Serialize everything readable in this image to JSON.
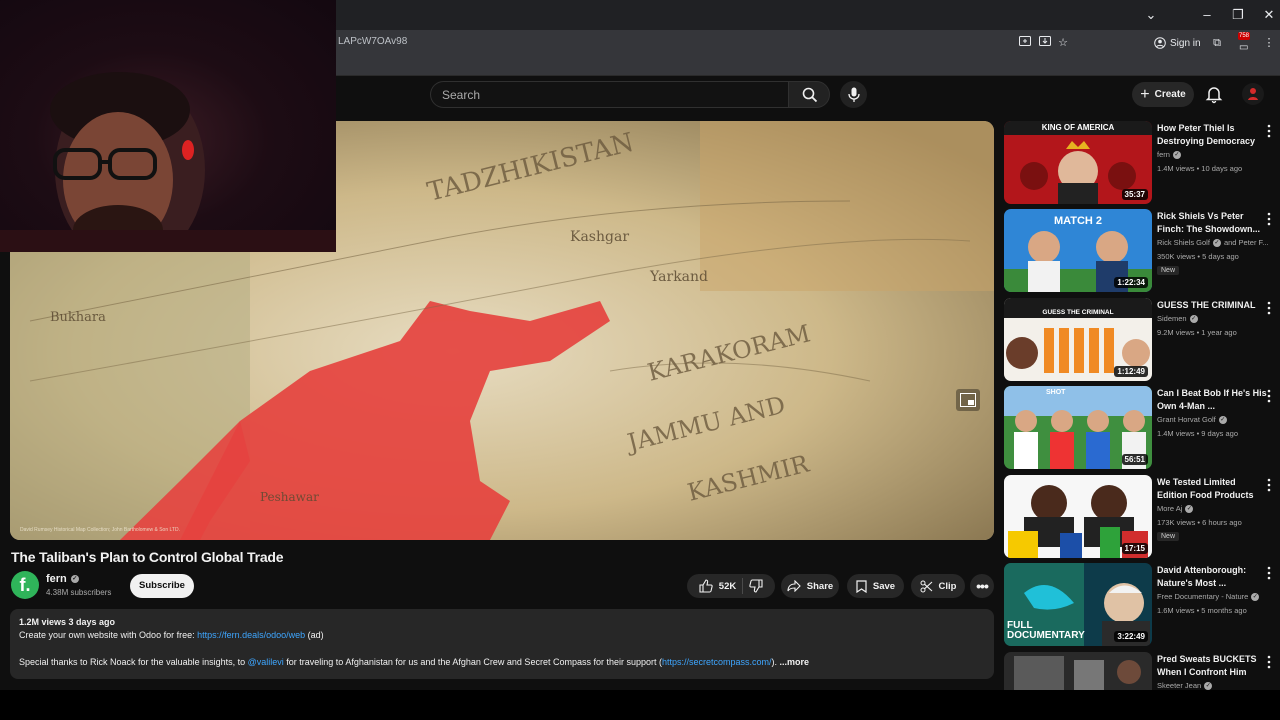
{
  "browser": {
    "url": "LAPcW7OAv98",
    "signin_label": "Sign in",
    "ext_badge": "758"
  },
  "header": {
    "search_placeholder": "Search",
    "create_label": "Create"
  },
  "video": {
    "title": "The Taliban's Plan to Control Global Trade",
    "map_credit": "David Rumsey Historical Map Collection; John Bartholomew & Son LTD."
  },
  "channel": {
    "name": "fern",
    "avatar_letter": "f.",
    "subscribers": "4.38M subscribers",
    "subscribe_label": "Subscribe"
  },
  "actions": {
    "likes": "52K",
    "share": "Share",
    "save": "Save",
    "clip": "Clip"
  },
  "description": {
    "meta": "1.2M views  3 days ago",
    "line1_text": "Create your own website with Odoo for free: ",
    "line1_link": "https://fern.deals/odoo/web",
    "line1_suffix": " (ad)",
    "line2_a": "Special thanks to Rick Noack for the valuable insights, to ",
    "line2_handle": "@valilevi",
    "line2_b": " for traveling to Afghanistan for us and the Afghan Crew and Secret Compass for their support (",
    "line2_link": "https://secretcompass.com/",
    "line2_c": "). ",
    "more": "...more"
  },
  "recommendations": [
    {
      "title": "How Peter Thiel Is Destroying Democracy",
      "channel": "fern",
      "meta": "1.4M views • 10 days ago",
      "duration": "35:37",
      "badge": "",
      "thumb_text": "KING OF AMERICA"
    },
    {
      "title": "Rick Shiels Vs Peter Finch: The Showdown...",
      "channel": "Rick Shiels Golf",
      "channel_extra": "and Peter F...",
      "meta": "350K views • 5 days ago",
      "duration": "1:22:34",
      "badge": "New",
      "thumb_text": "MATCH 2"
    },
    {
      "title": "GUESS THE CRIMINAL",
      "channel": "Sidemen",
      "meta": "9.2M views • 1 year ago",
      "duration": "1:12:49",
      "badge": "",
      "thumb_text": "GUESS THE CRIMINAL"
    },
    {
      "title": "Can I Beat Bob If He's His Own 4-Man ...",
      "channel": "Grant Horvat Golf",
      "meta": "1.4M views • 9 days ago",
      "duration": "56:51",
      "badge": "",
      "thumb_text": "SHOT"
    },
    {
      "title": "We Tested Limited Edition Food Products",
      "channel": "More Aj",
      "meta": "173K views • 6 hours ago",
      "duration": "17:15",
      "badge": "New",
      "thumb_text": ""
    },
    {
      "title": "David Attenborough: Nature's Most ...",
      "channel": "Free Documentary - Nature",
      "meta": "1.6M views • 5 months ago",
      "duration": "3:22:49",
      "badge": "",
      "thumb_text": "FULL DOCUMENTARY"
    },
    {
      "title": "Pred Sweats BUCKETS When I Confront Him",
      "channel": "Skeeter Jean",
      "meta": "",
      "duration": "",
      "badge": "",
      "thumb_text": ""
    }
  ],
  "colors": {
    "background": "#0f0f0f",
    "surface": "#272727",
    "link": "#3ea6ff",
    "map_red": "#e5433f"
  }
}
